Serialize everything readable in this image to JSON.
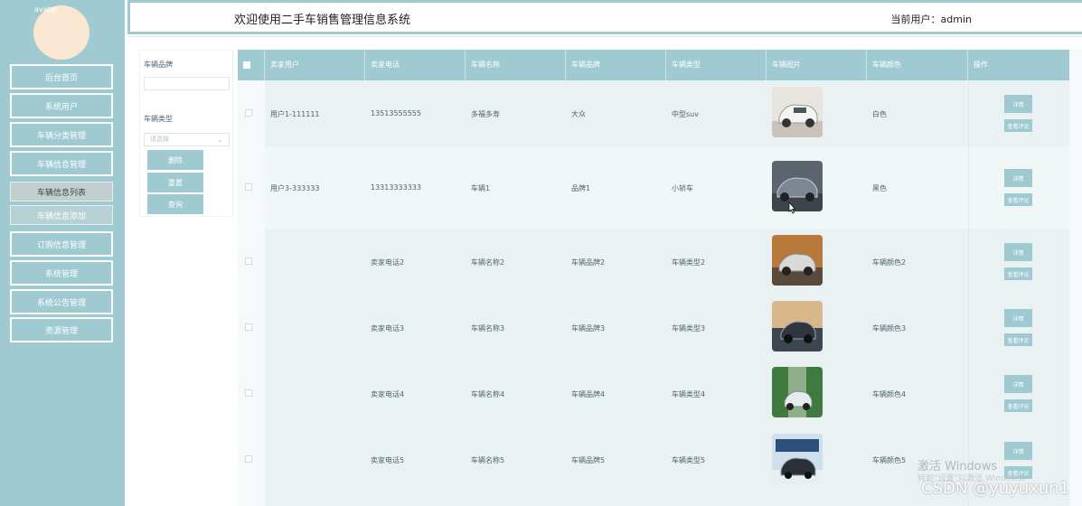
{
  "header": {
    "title": "欢迎使用二手车销售管理信息系统",
    "current_user": "当前用户：admin"
  },
  "sidebar": {
    "avatar_alt": "avatar",
    "items": [
      {
        "label": "后台首页"
      },
      {
        "label": "系统用户"
      },
      {
        "label": "车辆分类管理"
      },
      {
        "label": "车辆信息管理"
      },
      {
        "label": "车辆信息列表"
      },
      {
        "label": "车辆信息添加"
      },
      {
        "label": "订购信息管理"
      },
      {
        "label": "系统管理"
      },
      {
        "label": "系统公告管理"
      },
      {
        "label": "资源管理"
      }
    ]
  },
  "filter": {
    "brand_label": "车辆品牌",
    "brand_value": "",
    "type_label": "车辆类型",
    "type_placeholder": "请选择",
    "delete_btn": "删除",
    "reset_btn": "重置",
    "query_btn": "查询"
  },
  "table": {
    "columns": [
      "卖家用户",
      "卖家电话",
      "车辆名称",
      "车辆品牌",
      "车辆类型",
      "车辆图片",
      "车辆颜色",
      "操作"
    ],
    "detail_btn": "详情",
    "comment_btn": "查看评论",
    "rows": [
      {
        "seller": "用户1-111111",
        "phone": "13513555555",
        "name": "多福多寿",
        "brand": "大众",
        "type": "中型suv",
        "color": "白色"
      },
      {
        "seller": "用户3-333333",
        "phone": "13313333333",
        "name": "车辆1",
        "brand": "品牌1",
        "type": "小轿车",
        "color": "黑色"
      },
      {
        "seller": "",
        "phone": "卖家电话2",
        "name": "车辆名称2",
        "brand": "车辆品牌2",
        "type": "车辆类型2",
        "color": "车辆颜色2"
      },
      {
        "seller": "",
        "phone": "卖家电话3",
        "name": "车辆名称3",
        "brand": "车辆品牌3",
        "type": "车辆类型3",
        "color": "车辆颜色3"
      },
      {
        "seller": "",
        "phone": "卖家电话4",
        "name": "车辆名称4",
        "brand": "车辆品牌4",
        "type": "车辆类型4",
        "color": "车辆颜色4"
      },
      {
        "seller": "",
        "phone": "卖家电话5",
        "name": "车辆名称5",
        "brand": "车辆品牌5",
        "type": "车辆类型5",
        "color": "车辆颜色5"
      }
    ]
  },
  "watermark": {
    "line1": "激活 Windows",
    "line2": "转到“设置”以激活 Windows。",
    "csdn": "CSDN @yuyuxun1"
  },
  "colors": {
    "accent": "#9fcad2",
    "row_odd": "#eaf1f3",
    "row_even": "#f1f6f7"
  }
}
